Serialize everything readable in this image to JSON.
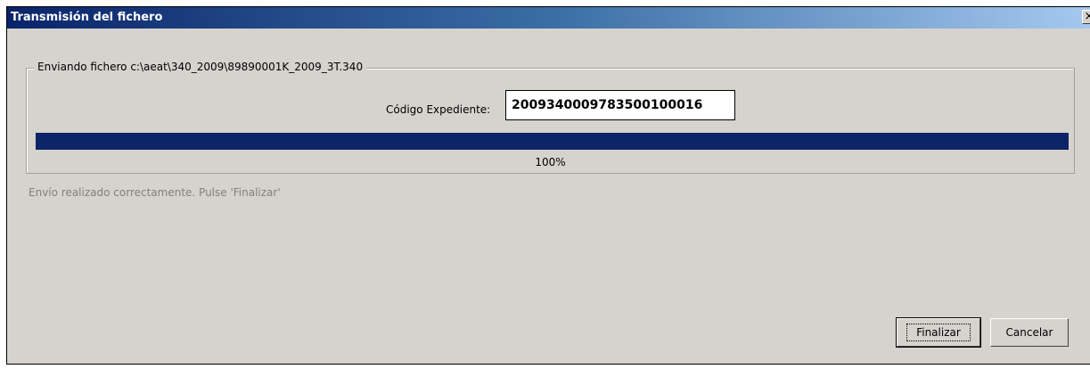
{
  "window": {
    "title": "Transmisión del fichero",
    "close_glyph": "×"
  },
  "group": {
    "legend": "Enviando fichero c:\\aeat\\340_2009\\89890001K_2009_3T.340"
  },
  "codigo": {
    "label": "Código Expediente:",
    "value": "2009340009783500100016"
  },
  "progress": {
    "value_percent": 100,
    "text": "100%",
    "fill_color": "#0a2466"
  },
  "status": {
    "message": "Envío realizado correctamente. Pulse 'Finalizar'"
  },
  "buttons": {
    "finalizar": "Finalizar",
    "cancelar": "Cancelar"
  },
  "colors": {
    "titlebar_start": "#0a246a",
    "titlebar_end": "#a6caf0",
    "window_bg": "#d6d3ce"
  }
}
